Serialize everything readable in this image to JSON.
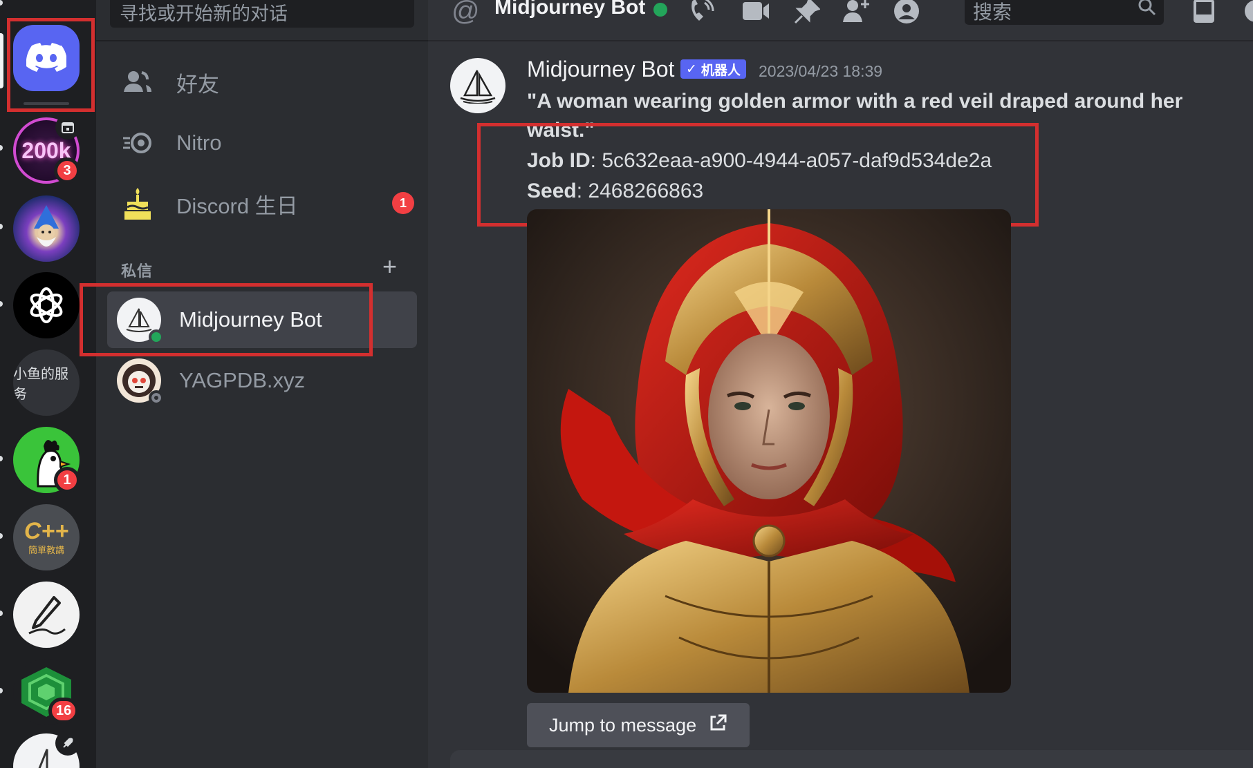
{
  "rail": {
    "servers": [
      {
        "name": "discord-home"
      },
      {
        "name": "200k-server",
        "text": "200k",
        "badge": "3"
      },
      {
        "name": "wizard-server"
      },
      {
        "name": "openai-server"
      },
      {
        "name": "xiaoyu-server",
        "text": "小鱼的服务"
      },
      {
        "name": "chicken-server",
        "badge": "1"
      },
      {
        "name": "cpp-server",
        "text": "C++",
        "subtext": "簡單教講"
      },
      {
        "name": "sketch-server"
      },
      {
        "name": "cube-server",
        "badge": "16"
      },
      {
        "name": "sailboat-server"
      }
    ]
  },
  "dm": {
    "search_placeholder": "寻找或开始新的对话",
    "nav": [
      {
        "label": "好友",
        "icon": "friends-icon"
      },
      {
        "label": "Nitro",
        "icon": "nitro-icon"
      },
      {
        "label": "Discord 生日",
        "icon": "birthday-cake-icon",
        "badge": "1"
      }
    ],
    "section_title": "私信",
    "add_label": "+",
    "users": [
      {
        "name": "Midjourney Bot",
        "status": "online",
        "active": true
      },
      {
        "name": "YAGPDB.xyz",
        "status": "offline",
        "active": false
      }
    ]
  },
  "header": {
    "at_symbol": "@",
    "channel_name": "Midjourney Bot",
    "search_placeholder": "搜索"
  },
  "message": {
    "author": "Midjourney Bot",
    "bot_tag": "机器人",
    "check": "✓",
    "timestamp": "2023/04/23 18:39",
    "prompt": "\"A woman wearing golden armor with a red veil draped around her waist.\"",
    "job_id_label": "Job ID",
    "job_id_value": ": 5c632eaa-a900-4944-a057-daf9d534de2a",
    "seed_label": "Seed",
    "seed_value": ": 2468266863",
    "jump_label": "Jump to message"
  },
  "colors": {
    "highlight": "#d32f2f",
    "online": "#23a55a",
    "blurple": "#5865f2",
    "badge_red": "#f23f43"
  }
}
